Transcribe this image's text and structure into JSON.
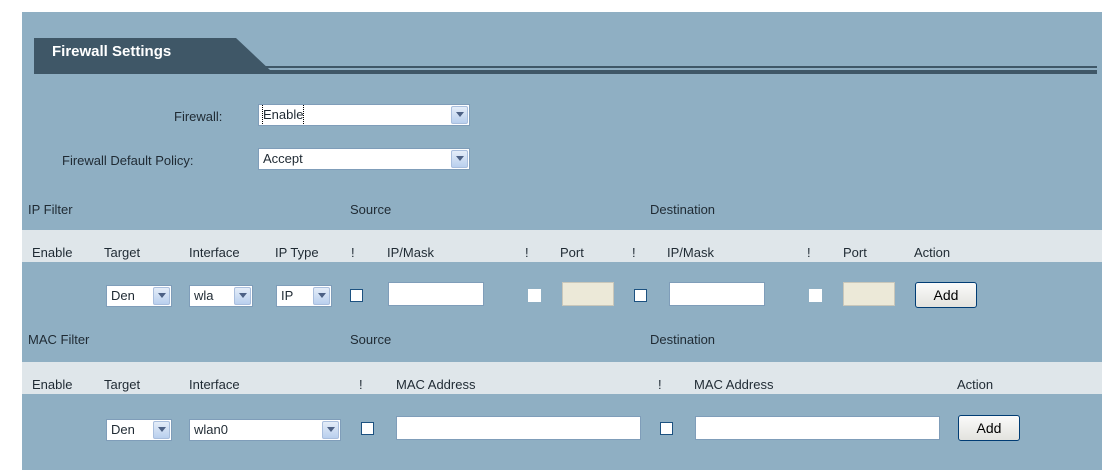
{
  "title": "Firewall Settings",
  "firewall": {
    "label": "Firewall:",
    "value": "Enable"
  },
  "default_policy": {
    "label": "Firewall Default Policy:",
    "value": "Accept"
  },
  "ip_filter": {
    "section_label": "IP Filter",
    "source_label": "Source",
    "destination_label": "Destination",
    "headers": {
      "enable": "Enable",
      "target": "Target",
      "interface": "Interface",
      "ip_type": "IP Type",
      "not1": "!",
      "src_ipmask": "IP/Mask",
      "not2": "!",
      "src_port": "Port",
      "not3": "!",
      "dst_ipmask": "IP/Mask",
      "not4": "!",
      "dst_port": "Port",
      "action": "Action"
    },
    "row": {
      "target": "Den",
      "interface": "wla",
      "ip_type": "IP",
      "add_label": "Add"
    }
  },
  "mac_filter": {
    "section_label": "MAC Filter",
    "source_label": "Source",
    "destination_label": "Destination",
    "headers": {
      "enable": "Enable",
      "target": "Target",
      "interface": "Interface",
      "not1": "!",
      "src_mac": "MAC Address",
      "not2": "!",
      "dst_mac": "MAC Address",
      "action": "Action"
    },
    "row": {
      "target": "Den",
      "interface": "wlan0",
      "add_label": "Add"
    }
  }
}
